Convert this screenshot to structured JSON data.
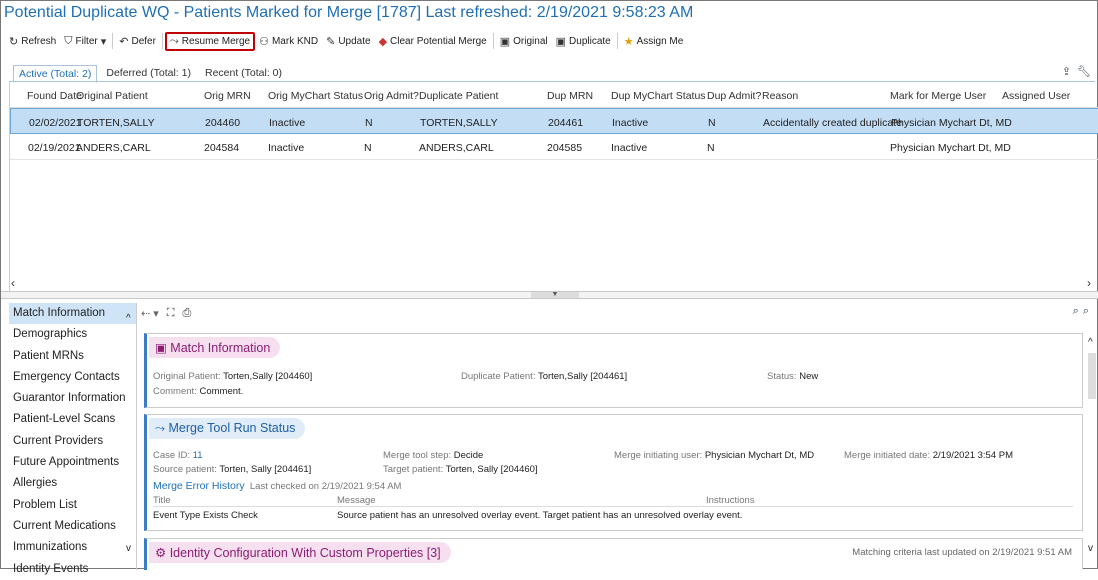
{
  "title": "Potential Duplicate WQ - Patients Marked for Merge [1787] Last refreshed: 2/19/2021 9:58:23 AM",
  "toolbar": {
    "refresh": "Refresh",
    "filter": "Filter",
    "defer": "Defer",
    "resume_merge": "Resume Merge",
    "mark_knd": "Mark KND",
    "update": "Update",
    "clear_potential_merge": "Clear Potential Merge",
    "original": "Original",
    "duplicate": "Duplicate",
    "assign_me": "Assign Me"
  },
  "tabs": [
    {
      "label": "Active (Total: 2)",
      "active": true
    },
    {
      "label": "Deferred (Total: 1)",
      "active": false
    },
    {
      "label": "Recent (Total: 0)",
      "active": false
    }
  ],
  "grid": {
    "headers": [
      "Found Date",
      "Original Patient",
      "Orig MRN",
      "Orig MyChart Status",
      "Orig Admit?",
      "Duplicate Patient",
      "Dup MRN",
      "Dup MyChart Status",
      "Dup Admit?",
      "Reason",
      "Mark for Merge User",
      "Assigned User"
    ],
    "rows": [
      {
        "found_date": "02/02/2021",
        "orig_patient": "TORTEN,SALLY",
        "orig_mrn": "204460",
        "orig_mychart": "Inactive",
        "orig_admit": "N",
        "dup_patient": "TORTEN,SALLY",
        "dup_mrn": "204461",
        "dup_mychart": "Inactive",
        "dup_admit": "N",
        "reason": "Accidentally created duplicate",
        "mark_user": "Physician Mychart Dt, MD",
        "assigned": "",
        "selected": true
      },
      {
        "found_date": "02/19/2021",
        "orig_patient": "ANDERS,CARL",
        "orig_mrn": "204584",
        "orig_mychart": "Inactive",
        "orig_admit": "N",
        "dup_patient": "ANDERS,CARL",
        "dup_mrn": "204585",
        "dup_mychart": "Inactive",
        "dup_admit": "N",
        "reason": "",
        "mark_user": "Physician Mychart Dt, MD",
        "assigned": "",
        "selected": false
      }
    ]
  },
  "sidebar": {
    "items": [
      "Match Information",
      "Demographics",
      "Patient MRNs",
      "Emergency Contacts",
      "Guarantor Information",
      "Patient-Level Scans",
      "Current Providers",
      "Future Appointments",
      "Allergies",
      "Problem List",
      "Current Medications",
      "Immunizations",
      "Identity Events"
    ]
  },
  "match_info": {
    "heading": "Match Information",
    "original_label": "Original Patient:",
    "original_value": "Torten,Sally [204460]",
    "duplicate_label": "Duplicate Patient:",
    "duplicate_value": "Torten,Sally [204461]",
    "status_label": "Status:",
    "status_value": "New",
    "comment_label": "Comment:",
    "comment_value": "Comment."
  },
  "merge_tool": {
    "heading": "Merge Tool Run Status",
    "case_id_label": "Case ID:",
    "case_id_value": "11",
    "step_label": "Merge tool step:",
    "step_value": "Decide",
    "init_user_label": "Merge initiating user:",
    "init_user_value": "Physician Mychart Dt, MD",
    "init_date_label": "Merge initiated date:",
    "init_date_value": "2/19/2021  3:54 PM",
    "source_label": "Source patient:",
    "source_value": "Torten, Sally [204461]",
    "target_label": "Target patient:",
    "target_value": "Torten, Sally [204460]",
    "error_history": "Merge Error History",
    "last_checked": "Last checked on 2/19/2021  9:54 AM",
    "cols": [
      "Title",
      "Message",
      "Instructions"
    ],
    "error_title": "Event Type Exists Check",
    "error_message": "Source patient has an unresolved overlay event. Target patient has an unresolved overlay event.",
    "error_instructions": ""
  },
  "identity_config": {
    "heading": "Identity Configuration With Custom Properties [3]",
    "matching_note": "Matching criteria last updated on 2/19/2021  9:51 AM"
  }
}
